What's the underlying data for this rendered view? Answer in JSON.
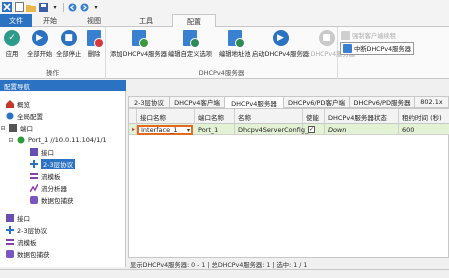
{
  "title_bar": {
    "quick_access": [
      "x-logo-icon",
      "new-doc-icon",
      "open-folder-icon",
      "save-icon",
      "dropdown-icon",
      "back-icon",
      "forward-icon",
      "dropdown-icon"
    ]
  },
  "ribbon_tabs": [
    {
      "label": "文件"
    },
    {
      "label": "开始"
    },
    {
      "label": "视图"
    },
    {
      "label": "工具"
    },
    {
      "label": "配置"
    }
  ],
  "ribbon": {
    "ops_group": {
      "label": "操作",
      "buttons": [
        {
          "label": "应用"
        },
        {
          "label": "全部开始"
        },
        {
          "label": "全部停止"
        },
        {
          "label": "删除"
        }
      ]
    },
    "dhcp_group": {
      "label": "DHCPv4服务器",
      "buttons": [
        {
          "label": "添加DHCPv4服务器"
        },
        {
          "label": "编辑自定义选项"
        },
        {
          "label": "编辑地址池"
        },
        {
          "label": "启动DHCPv4服务器"
        },
        {
          "label": "停止DHCPv4服务器"
        }
      ]
    },
    "side_buttons": [
      {
        "label": "强制客户端续租"
      },
      {
        "label": "中断DHCPv4服务器"
      }
    ]
  },
  "nav": {
    "header": "配置导航",
    "tree": [
      {
        "label": "概览"
      },
      {
        "label": "全局配置"
      },
      {
        "label": "端口"
      },
      {
        "label": "Port_1 //10.0.11.104/1/1"
      },
      {
        "label": "接口"
      },
      {
        "label": "2-3层协议"
      },
      {
        "label": "流模板"
      },
      {
        "label": "流分析器"
      },
      {
        "label": "数据包捕获"
      },
      {
        "label": "接口"
      },
      {
        "label": "2-3层协议"
      },
      {
        "label": "流模板"
      },
      {
        "label": "数据包捕获"
      }
    ]
  },
  "detail_tabs": [
    {
      "label": "2-3层协议"
    },
    {
      "label": "DHCPv4客户端"
    },
    {
      "label": "DHCPv4服务器"
    },
    {
      "label": "DHCPv6/PD客户端"
    },
    {
      "label": "DHCPv6/PD服务器"
    },
    {
      "label": "802.1x"
    }
  ],
  "grid": {
    "columns": [
      "接口名称",
      "端口名称",
      "名称",
      "使能",
      "DHCPv4服务器状态",
      "租约时间 (秒)"
    ],
    "rows": [
      {
        "marker": "▸",
        "interface": "Interface_1",
        "port": "Port_1",
        "name": "Dhcpv4ServerConfig_1",
        "enabled": "✓",
        "status": "Down",
        "lease": "600"
      }
    ]
  },
  "status_text": "显示DHCPv4服务器: 0 - 1 | 总DHCPv4服务器: 1 | 选中: 1 / 1"
}
